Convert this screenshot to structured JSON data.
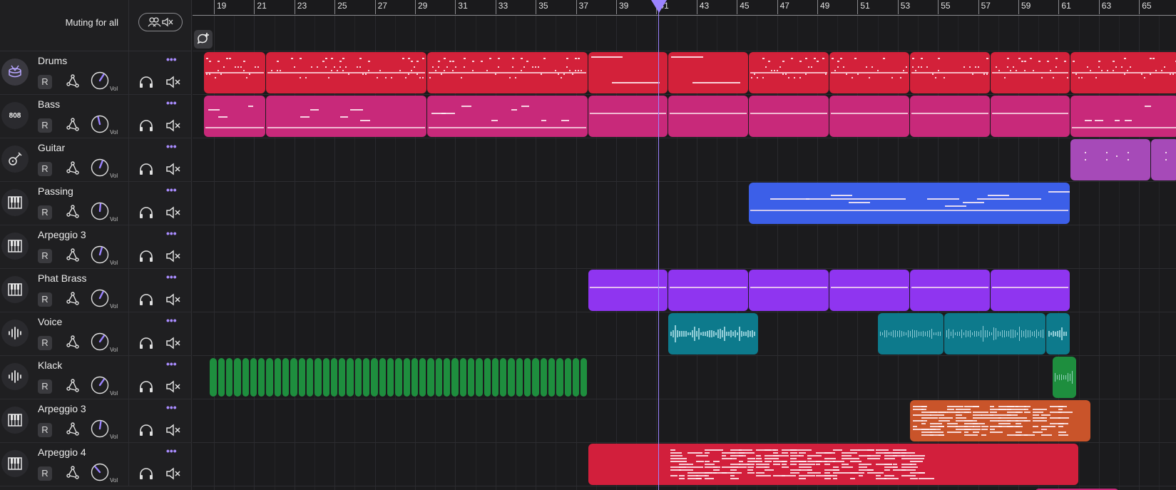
{
  "mute_bar": {
    "label": "Muting for all"
  },
  "ruler": {
    "labels": [
      "19",
      "21",
      "23",
      "25",
      "27",
      "29",
      "31",
      "33",
      "35",
      "37",
      "39",
      "41",
      "43",
      "45",
      "47",
      "49",
      "51",
      "53",
      "55",
      "57",
      "59",
      "61",
      "63",
      "65"
    ]
  },
  "playhead": {
    "bar": "41"
  },
  "tracks": [
    {
      "name": "Drums",
      "icon": "drum-icon",
      "selected": true,
      "record_label": "R",
      "vol_label": "Vol",
      "vol": 0.62
    },
    {
      "name": "Bass",
      "icon": "808-icon",
      "icon_text": "808",
      "selected": false,
      "record_label": "R",
      "vol_label": "Vol",
      "vol": 0.45
    },
    {
      "name": "Guitar",
      "icon": "guitar-icon",
      "selected": false,
      "record_label": "R",
      "vol_label": "Vol",
      "vol": 0.58
    },
    {
      "name": "Passing",
      "icon": "piano-icon",
      "selected": false,
      "record_label": "R",
      "vol_label": "Vol",
      "vol": 0.52
    },
    {
      "name": "Arpeggio 3",
      "icon": "piano-icon",
      "selected": false,
      "record_label": "R",
      "vol_label": "Vol",
      "vol": 0.56
    },
    {
      "name": "Phat Brass",
      "icon": "piano-icon",
      "selected": false,
      "record_label": "R",
      "vol_label": "Vol",
      "vol": 0.6
    },
    {
      "name": "Voice",
      "icon": "waveform-icon",
      "selected": false,
      "record_label": "R",
      "vol_label": "Vol",
      "vol": 0.63
    },
    {
      "name": "Klack",
      "icon": "waveform-icon",
      "selected": false,
      "record_label": "R",
      "vol_label": "Vol",
      "vol": 0.63
    },
    {
      "name": "Arpeggio 3",
      "icon": "piano-icon",
      "selected": false,
      "record_label": "R",
      "vol_label": "Vol",
      "vol": 0.53
    },
    {
      "name": "Arpeggio 4",
      "icon": "piano-icon",
      "selected": false,
      "record_label": "R",
      "vol_label": "Vol",
      "vol": 0.35
    }
  ],
  "colors": {
    "drums": "#d3213a",
    "bass": "#c8297a",
    "guitar": "#a64ab8",
    "passing": "#3c5fe8",
    "brass": "#8f35f0",
    "voice": "#0d7a8c",
    "klack": "#1e8e3e",
    "arp3": "#c9542a",
    "arp4": "#d21f3c",
    "accent": "#9b83ff"
  },
  "clips": [
    {
      "track": 0,
      "start": 18.5,
      "end": 21.6,
      "color": "drums",
      "kind": "drums"
    },
    {
      "track": 0,
      "start": 21.6,
      "end": 29.6,
      "color": "drums",
      "kind": "drums"
    },
    {
      "track": 0,
      "start": 29.6,
      "end": 37.6,
      "color": "drums",
      "kind": "drums"
    },
    {
      "track": 0,
      "start": 37.6,
      "end": 41.6,
      "color": "drums",
      "kind": "sparse"
    },
    {
      "track": 0,
      "start": 41.6,
      "end": 45.6,
      "color": "drums",
      "kind": "sparse"
    },
    {
      "track": 0,
      "start": 45.6,
      "end": 49.6,
      "color": "drums",
      "kind": "drums"
    },
    {
      "track": 0,
      "start": 49.6,
      "end": 53.6,
      "color": "drums",
      "kind": "drums"
    },
    {
      "track": 0,
      "start": 53.6,
      "end": 57.6,
      "color": "drums",
      "kind": "drums"
    },
    {
      "track": 0,
      "start": 57.6,
      "end": 61.6,
      "color": "drums",
      "kind": "drums"
    },
    {
      "track": 0,
      "start": 61.6,
      "end": 67,
      "color": "drums",
      "kind": "drums"
    },
    {
      "track": 1,
      "start": 18.5,
      "end": 21.6,
      "color": "bass",
      "kind": "bass"
    },
    {
      "track": 1,
      "start": 21.6,
      "end": 29.6,
      "color": "bass",
      "kind": "bass"
    },
    {
      "track": 1,
      "start": 29.6,
      "end": 37.6,
      "color": "bass",
      "kind": "bass"
    },
    {
      "track": 1,
      "start": 37.6,
      "end": 41.6,
      "color": "bass",
      "kind": "line"
    },
    {
      "track": 1,
      "start": 41.6,
      "end": 45.6,
      "color": "bass",
      "kind": "line"
    },
    {
      "track": 1,
      "start": 45.6,
      "end": 49.6,
      "color": "bass",
      "kind": "line"
    },
    {
      "track": 1,
      "start": 49.6,
      "end": 53.6,
      "color": "bass",
      "kind": "line"
    },
    {
      "track": 1,
      "start": 53.6,
      "end": 57.6,
      "color": "bass",
      "kind": "line"
    },
    {
      "track": 1,
      "start": 57.6,
      "end": 61.6,
      "color": "bass",
      "kind": "line"
    },
    {
      "track": 1,
      "start": 61.6,
      "end": 67,
      "color": "bass",
      "kind": "bass"
    },
    {
      "track": 2,
      "start": 61.6,
      "end": 65.6,
      "color": "guitar",
      "kind": "dots"
    },
    {
      "track": 2,
      "start": 65.6,
      "end": 67,
      "color": "guitar",
      "kind": "dots"
    },
    {
      "track": 3,
      "start": 45.6,
      "end": 61.6,
      "color": "passing",
      "kind": "passing"
    },
    {
      "track": 5,
      "start": 37.6,
      "end": 41.6,
      "color": "brass",
      "kind": "line"
    },
    {
      "track": 5,
      "start": 41.6,
      "end": 45.6,
      "color": "brass",
      "kind": "line"
    },
    {
      "track": 5,
      "start": 45.6,
      "end": 49.6,
      "color": "brass",
      "kind": "line"
    },
    {
      "track": 5,
      "start": 49.6,
      "end": 53.6,
      "color": "brass",
      "kind": "line"
    },
    {
      "track": 5,
      "start": 53.6,
      "end": 57.6,
      "color": "brass",
      "kind": "line"
    },
    {
      "track": 5,
      "start": 57.6,
      "end": 61.6,
      "color": "brass",
      "kind": "line"
    },
    {
      "track": 6,
      "start": 41.6,
      "end": 46.1,
      "color": "voice",
      "kind": "wave"
    },
    {
      "track": 6,
      "start": 52.0,
      "end": 55.3,
      "color": "voice",
      "kind": "wave"
    },
    {
      "track": 6,
      "start": 55.3,
      "end": 60.4,
      "color": "voice",
      "kind": "wave"
    },
    {
      "track": 6,
      "start": 60.4,
      "end": 61.6,
      "color": "voice",
      "kind": "wave"
    },
    {
      "track": 7,
      "start": 18.8,
      "end": 37.8,
      "color": "klack",
      "kind": "klack"
    },
    {
      "track": 7,
      "start": 60.7,
      "end": 61.9,
      "color": "klack",
      "kind": "wave"
    },
    {
      "track": 8,
      "start": 53.6,
      "end": 62.6,
      "color": "arp3",
      "kind": "arp"
    },
    {
      "track": 9,
      "start": 37.6,
      "end": 62.0,
      "color": "arp4",
      "kind": "arp4"
    }
  ]
}
